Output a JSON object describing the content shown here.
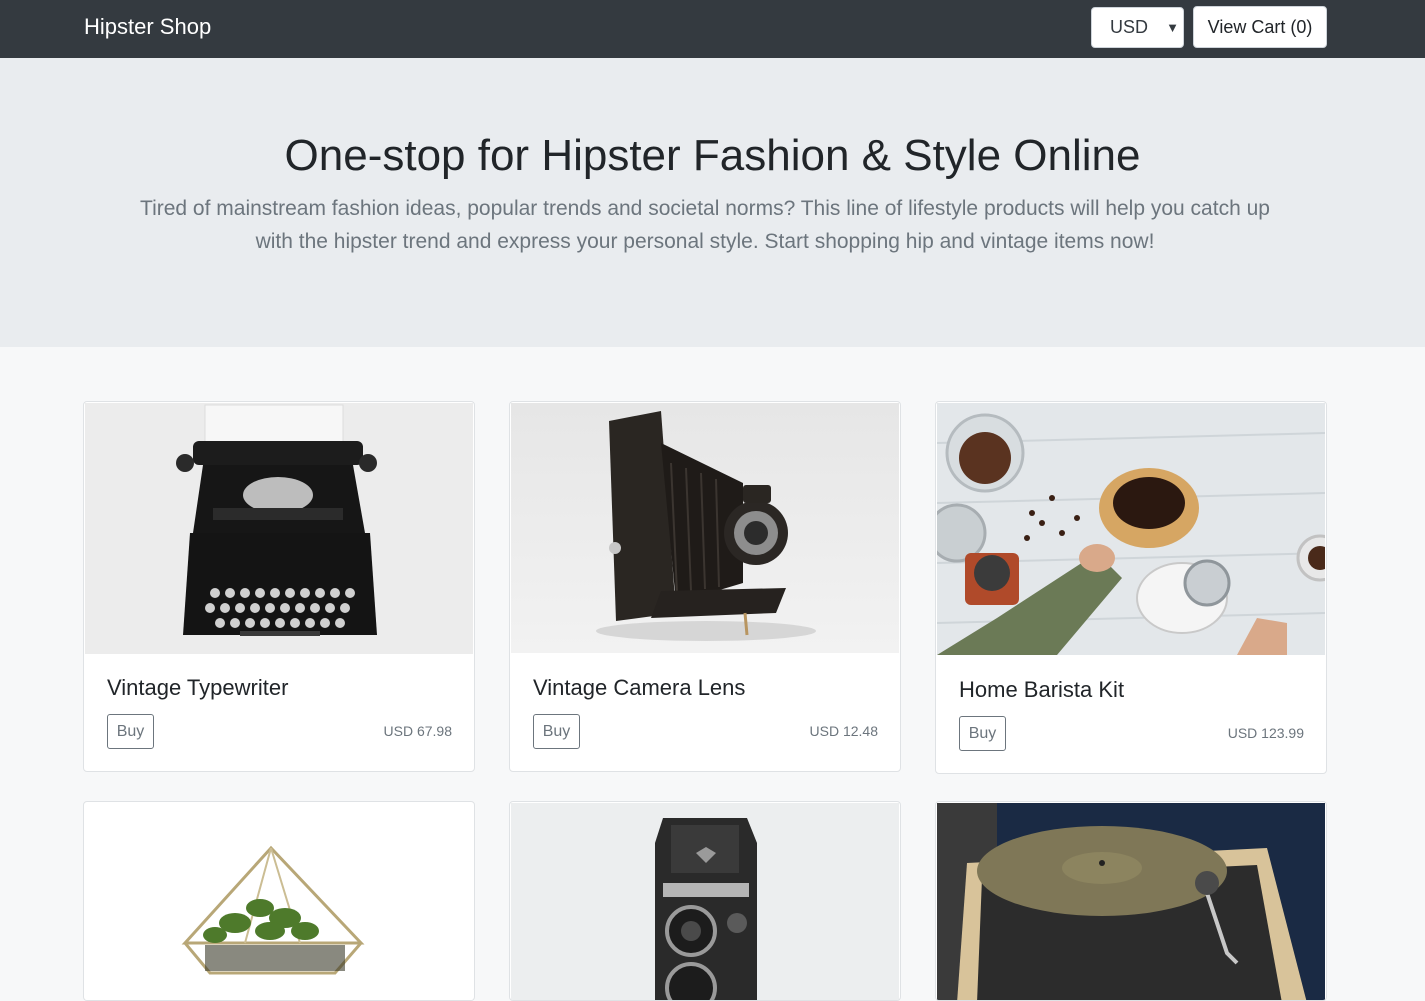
{
  "header": {
    "brand": "Hipster Shop",
    "currency": {
      "selected": "USD",
      "caret_icon": "caret-down-icon"
    },
    "cart_button_label": "View Cart (0)"
  },
  "hero": {
    "title": "One-stop for Hipster Fashion & Style Online",
    "lead_line1": "Tired of mainstream fashion ideas, popular trends and societal norms? This line of lifestyle products will help you catch up",
    "lead_line2": "with the hipster trend and express your personal style. Start shopping hip and vintage items now!"
  },
  "products": [
    {
      "name": "Vintage Typewriter",
      "buy_label": "Buy",
      "price": "USD 67.98",
      "image": "typewriter-image"
    },
    {
      "name": "Vintage Camera Lens",
      "buy_label": "Buy",
      "price": "USD 12.48",
      "image": "camera-image"
    },
    {
      "name": "Home Barista Kit",
      "buy_label": "Buy",
      "price": "USD 123.99",
      "image": "barista-kit-image"
    },
    {
      "name": "",
      "buy_label": "",
      "price": "",
      "image": "terrarium-image"
    },
    {
      "name": "",
      "buy_label": "",
      "price": "",
      "image": "twin-lens-camera-image"
    },
    {
      "name": "",
      "buy_label": "",
      "price": "",
      "image": "record-player-image"
    }
  ],
  "colors": {
    "navbar": "#343a40",
    "hero_background": "#e9ecef",
    "page_background": "#f7f8f9",
    "muted_text": "#6c757d"
  }
}
